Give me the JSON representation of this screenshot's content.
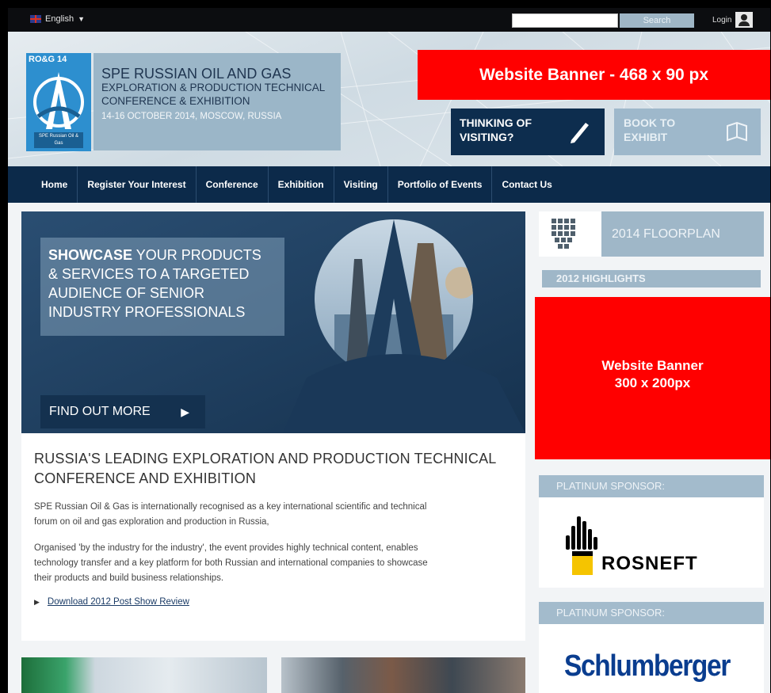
{
  "topbar": {
    "language": "English",
    "search_placeholder": "",
    "search_button": "Search",
    "login": "Login"
  },
  "header": {
    "logo_text": "RO&G 14",
    "logo_sub": "SPE Russian Oil & Gas",
    "conf_title": "SPE RUSSIAN OIL AND GAS",
    "conf_sub_1": "EXPLORATION & PRODUCTION TECHNICAL",
    "conf_sub_2": "CONFERENCE & EXHIBITION",
    "conf_date": "14-16 OCTOBER 2014, MOSCOW, RUSSIA",
    "banner_468": "Website Banner - 468 x 90 px",
    "visit_line1": "THINKING OF",
    "visit_line2": "VISITING?",
    "exhibit_line1": "BOOK TO",
    "exhibit_line2": "EXHIBIT"
  },
  "nav": {
    "items": [
      "Home",
      "Register Your Interest",
      "Conference",
      "Exhibition",
      "Visiting",
      "Portfolio of Events",
      "Contact Us"
    ]
  },
  "hero": {
    "highlight": "SHOWCASE",
    "text_1": " YOUR PRODUCTS",
    "text_2": "& SERVICES TO A TARGETED",
    "text_3": "AUDIENCE OF SENIOR",
    "text_4": "INDUSTRY PROFESSIONALS",
    "cta": "FIND OUT MORE"
  },
  "article": {
    "title_1": "RUSSIA'S LEADING EXPLORATION AND PRODUCTION TECHNICAL",
    "title_2": "CONFERENCE AND EXHIBITION",
    "p1_line1": "SPE Russian Oil & Gas is internationally recognised as a key international scientific and technical",
    "p1_line2": "forum on oil and gas exploration and production in Russia,",
    "p2_line1": "Organised 'by the industry for the industry', the event provides highly technical content, enables",
    "p2_line2": "technology transfer and a key platform for both Russian and international companies to showcase",
    "p2_line3": "their products and build business relationships.",
    "download_link": "Download 2012 Post Show Review"
  },
  "sidebar": {
    "floorplan": "2014 FLOORPLAN",
    "highlights": "2012 HIGHLIGHTS",
    "banner_300_line1": "Website Banner",
    "banner_300_line2": "300 x 200px",
    "sponsor_head": "PLATINUM SPONSOR:",
    "sponsor1": "ROSNEFT",
    "sponsor2": "Schlumberger"
  },
  "colors": {
    "navy": "#0c2a4a",
    "banner_red": "#ff0000",
    "panel_blue": "#9fb7c8",
    "schlumberger_blue": "#0a3d8f"
  }
}
